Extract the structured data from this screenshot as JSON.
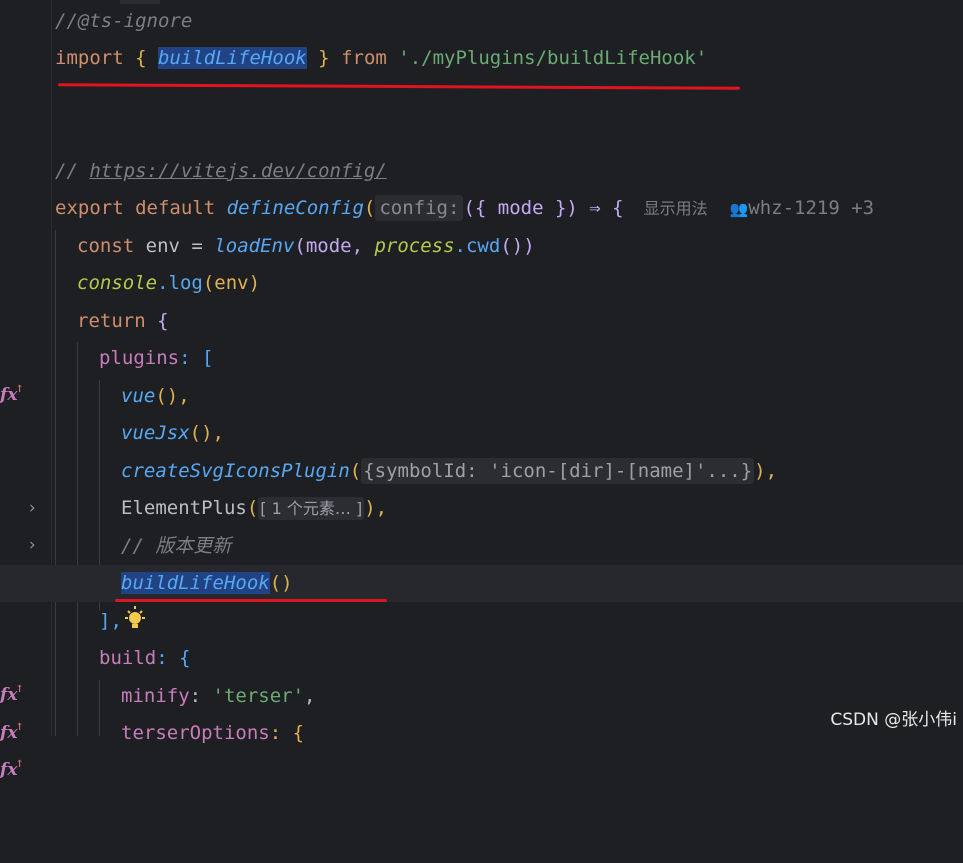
{
  "editor": {
    "lines": {
      "l1_comment": "//@ts-ignore",
      "l2_import": "import",
      "l2_brace_open": "{",
      "l2_name": "buildLifeHook",
      "l2_brace_close": "}",
      "l2_from": "from",
      "l2_path": "'./myPlugins/buildLifeHook'",
      "l3_comment_prefix": "// ",
      "l3_link": "https://vitejs.dev/config/",
      "l4_export": "export",
      "l4_default": "default",
      "l4_fn": "defineConfig",
      "l4_hint": "config:",
      "l4_params": "({ mode }) ⇒ {",
      "l4_usage": "显示用法",
      "l4_author": "whz-1219 +3",
      "l5_const": "const",
      "l5_env": "env =",
      "l5_loadenv": "loadEnv",
      "l5_args_a": "(mode, ",
      "l5_process": "process",
      "l5_cwd": ".cwd",
      "l5_args_b": "())",
      "l6_console": "console",
      "l6_log": ".log",
      "l6_args": "(env)",
      "l7_return": "return",
      "l7_brace": "{",
      "l8_plugins": "plugins",
      "l8_rest": ": [",
      "l9_vue": "vue",
      "l9_rest": "(),",
      "l10_vuejsx": "vueJsx",
      "l10_rest": "(),",
      "l11_fn": "createSvgIconsPlugin",
      "l11_fold": "{symbolId: 'icon-[dir]-[name]'...}",
      "l11_rest": "),",
      "l12_fn": "ElementPlus",
      "l12_fold": "[ 1 个元素… ]",
      "l12_rest": "),",
      "l13_comment": "// 版本更新",
      "l14_fn": "buildLifeHook",
      "l14_rest": "()",
      "l15_close": "],",
      "l16_build": "build",
      "l16_rest": ": {",
      "l17_minify": "minify",
      "l17_colon": ": ",
      "l17_value": "'terser'",
      "l17_comma": ",",
      "l18_terser": "terserOptions",
      "l18_rest": ": {"
    }
  },
  "gutter": {
    "fx_label": "fx",
    "fx_sup": "↑",
    "chevron": "›"
  },
  "watermark": "CSDN @张小伟i",
  "colors": {
    "background": "#1e1f22",
    "keyword": "#cf8e6d",
    "function": "#56a8f5",
    "string": "#6aab73",
    "property": "#c77dbb",
    "annotation_line": "#e0141e"
  }
}
